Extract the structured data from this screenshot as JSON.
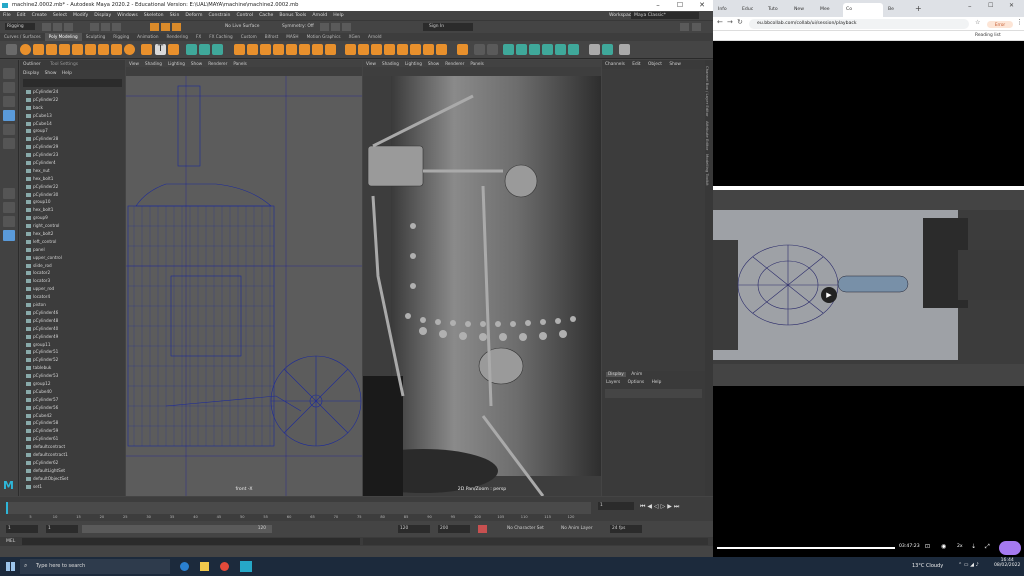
{
  "maya": {
    "title": "machine2.0002.mb* - Autodesk Maya 2020.2 - Educational Version: E:\\UAL\\MAYA\\machine\\machine2.0002.mb",
    "menu": [
      "File",
      "Edit",
      "Create",
      "Select",
      "Modify",
      "Display",
      "Windows",
      "Skeleton",
      "Skin",
      "Deform",
      "Constrain",
      "Control",
      "Cache",
      "Bonus Tools",
      "Arnold",
      "Help"
    ],
    "workspace_label": "Workspace :",
    "workspace_value": "Maya Classic*",
    "mode": "Rigging",
    "symmetry": "Symmetry: Off",
    "live_surface": "No Live Surface",
    "sign_in": "Sign In",
    "shelf_tabs": [
      "Curves / Surfaces",
      "Poly Modeling",
      "Sculpting",
      "Rigging",
      "Animation",
      "Rendering",
      "FX",
      "FX Caching",
      "Custom",
      "Bifrost",
      "MASH",
      "Motion Graphics",
      "XGen",
      "Arnold"
    ],
    "shelf_active": "Poly Modeling",
    "outliner": {
      "title": "Outliner",
      "tab2": "Tool Settings",
      "menu": [
        "Display",
        "Show",
        "Help"
      ],
      "items": [
        "pCylinder24",
        "pCylinder22",
        "back",
        "pCube13",
        "pCube14",
        "group7",
        "pCylinder28",
        "pCylinder29",
        "pCylinder23",
        "pCylinder4",
        "hex_nut",
        "hex_bolt1",
        "pCylinder22",
        "pCylinder30",
        "group10",
        "hex_bolt1",
        "group9",
        "right_control",
        "hex_bolt2",
        "left_control",
        "panel",
        "upper_control",
        "slide_rod",
        "locator2",
        "locator3",
        "upper_rod",
        "locator4",
        "piston",
        "pCylinder46",
        "pCylinder48",
        "pCylinder40",
        "pCylinder49",
        "group11",
        "pCylinder51",
        "pCylinder52",
        "tablebuk",
        "pCylinder53",
        "group12",
        "pCube40",
        "pCylinder57",
        "pCylinder56",
        "pCube42",
        "pCylinder58",
        "pCylinder59",
        "pCylinder61",
        "defaultcontract",
        "defaultcontract1",
        "pCylinder62",
        "defaultLightSet",
        "defaultObjectSet",
        "set1"
      ]
    },
    "viewports": [
      {
        "menu": [
          "View",
          "Shading",
          "Lighting",
          "Show",
          "Renderer",
          "Panels"
        ],
        "label": "front -X"
      },
      {
        "menu": [
          "View",
          "Shading",
          "Lighting",
          "Show",
          "Renderer",
          "Panels"
        ],
        "label": "2D Pan/Zoom : persp"
      }
    ],
    "channel_box": {
      "menu": [
        "Channels",
        "Edit",
        "Object",
        "Show"
      ]
    },
    "layer_editor": {
      "tabs": [
        "Display",
        "Anim"
      ],
      "menu": [
        "Layers",
        "Options",
        "Help"
      ]
    },
    "side_tabs": [
      "Channel Box / Layer Editor",
      "Attribute Editor",
      "Modelling Toolkit"
    ],
    "time": {
      "start": "1",
      "range_start": "1",
      "range_end": "120",
      "end": "120",
      "anim_end": "200",
      "current": "1",
      "character_set": "No Character Set",
      "anim_layer": "No Anim Layer",
      "fps": "24 fps",
      "ticks": [
        "5",
        "10",
        "15",
        "20",
        "25",
        "30",
        "35",
        "40",
        "45",
        "50",
        "55",
        "60",
        "65",
        "70",
        "75",
        "80",
        "85",
        "90",
        "95",
        "100",
        "105",
        "110",
        "115",
        "120"
      ]
    },
    "mel_label": "MEL",
    "logo_letter": "M"
  },
  "browser": {
    "tabs": [
      {
        "label": "Info"
      },
      {
        "label": "Educ"
      },
      {
        "label": "Tuto"
      },
      {
        "label": "New"
      },
      {
        "label": "Mee"
      },
      {
        "label": "Co"
      },
      {
        "label": "Be"
      }
    ],
    "new_tab": "+",
    "url": "eu.bbcollab.com/collab/ui/session/playback",
    "reading_list": "Reading list",
    "update_button": "Error",
    "video": {
      "time": "03:47:23",
      "speed": "2x"
    }
  },
  "taskbar": {
    "search_placeholder": "Type here to search",
    "weather": "13°C  Cloudy",
    "clock_time": "16:44",
    "clock_date": "08/02/2022"
  },
  "colors": {
    "maya_bg": "#444444",
    "shelf_orange": "#e8902c",
    "shelf_teal": "#3fa89a",
    "wireframe_blue": "#1c2a9a",
    "taskbar": "#1c2a3c",
    "accent_purple": "#a57af0"
  }
}
